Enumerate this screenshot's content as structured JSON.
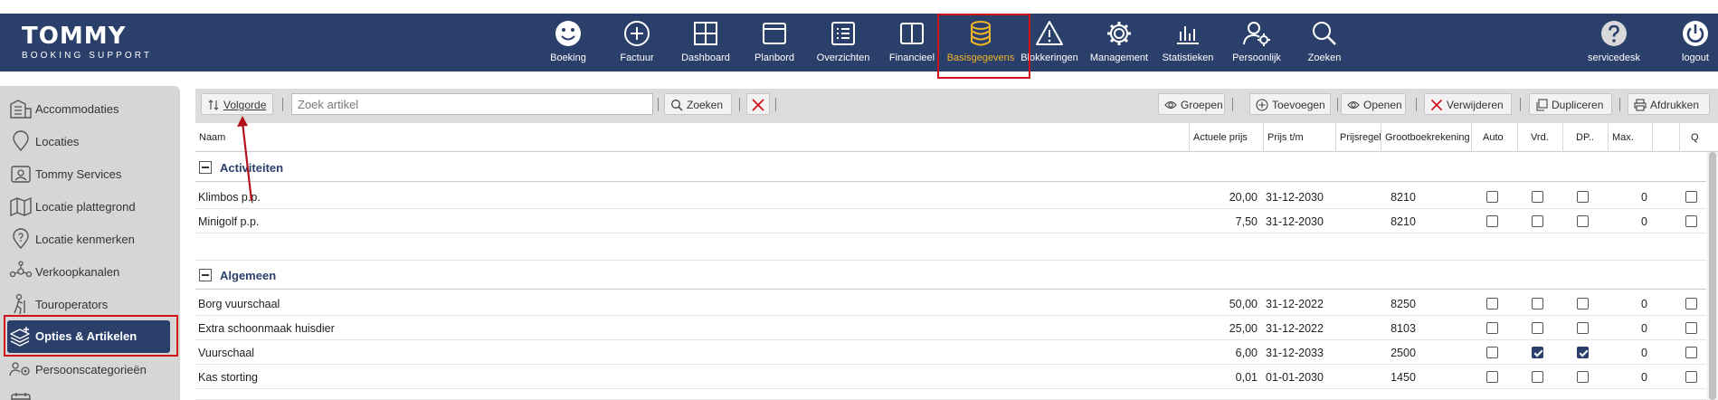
{
  "brand": {
    "name": "TOMMY",
    "tagline": "BOOKING SUPPORT"
  },
  "nav": [
    {
      "label": "Boeking",
      "icon": "smiley-icon"
    },
    {
      "label": "Factuur",
      "icon": "plus-circle-icon"
    },
    {
      "label": "Dashboard",
      "icon": "grid-icon"
    },
    {
      "label": "Planbord",
      "icon": "window-icon"
    },
    {
      "label": "Overzichten",
      "icon": "list-icon"
    },
    {
      "label": "Financieel",
      "icon": "columns-icon"
    },
    {
      "label": "Basisgegevens",
      "icon": "database-icon",
      "active": true
    },
    {
      "label": "Blokkeringen",
      "icon": "warning-icon"
    },
    {
      "label": "Management",
      "icon": "gear-icon"
    },
    {
      "label": "Statistieken",
      "icon": "bar-chart-icon"
    },
    {
      "label": "Persoonlijk",
      "icon": "user-gear-icon"
    },
    {
      "label": "Zoeken",
      "icon": "search-icon"
    }
  ],
  "nav_right": [
    {
      "label": "servicedesk",
      "icon": "help-icon"
    },
    {
      "label": "logout",
      "icon": "power-icon"
    }
  ],
  "sidebar": {
    "items": [
      {
        "label": "Accommodaties"
      },
      {
        "label": "Locaties"
      },
      {
        "label": "Tommy Services"
      },
      {
        "label": "Locatie plattegrond"
      },
      {
        "label": "Locatie kenmerken"
      },
      {
        "label": "Verkoopkanalen"
      },
      {
        "label": "Touroperators"
      },
      {
        "label": "Opties & Artikelen",
        "active": true
      },
      {
        "label": "Persoonscategorieën"
      }
    ]
  },
  "toolbar": {
    "sort_label": "Volgorde",
    "search_placeholder": "Zoek artikel",
    "search_label": "Zoeken",
    "groups_label": "Groepen",
    "add_label": "Toevoegen",
    "open_label": "Openen",
    "delete_label": "Verwijderen",
    "duplicate_label": "Dupliceren",
    "print_label": "Afdrukken"
  },
  "table": {
    "columns": [
      "Naam",
      "Actuele prijs",
      "Prijs t/m",
      "Prijsregel",
      "Grootboekrekening",
      "Auto",
      "Vrd.",
      "DP..",
      "Max.",
      "",
      "Q"
    ],
    "groups": [
      {
        "name": "Activiteiten",
        "rows": [
          {
            "name": "Klimbos p.p.",
            "price": "20,00",
            "until": "31-12-2030",
            "ledger": "8210",
            "auto": false,
            "vrd": false,
            "dp": false,
            "max": "0",
            "q": false
          },
          {
            "name": "Minigolf p.p.",
            "price": "7,50",
            "until": "31-12-2030",
            "ledger": "8210",
            "auto": false,
            "vrd": false,
            "dp": false,
            "max": "0",
            "q": false
          }
        ]
      },
      {
        "name": "Algemeen",
        "rows": [
          {
            "name": "Borg vuurschaal",
            "price": "50,00",
            "until": "31-12-2022",
            "ledger": "8250",
            "auto": false,
            "vrd": false,
            "dp": false,
            "max": "0",
            "q": false
          },
          {
            "name": "Extra schoonmaak huisdier",
            "price": "25,00",
            "until": "31-12-2022",
            "ledger": "8103",
            "auto": false,
            "vrd": false,
            "dp": false,
            "max": "0",
            "q": false
          },
          {
            "name": "Vuurschaal",
            "price": "6,00",
            "until": "31-12-2033",
            "ledger": "2500",
            "auto": false,
            "vrd": true,
            "dp": true,
            "max": "0",
            "q": false
          },
          {
            "name": "Kas storting",
            "price": "0,01",
            "until": "01-01-2030",
            "ledger": "1450",
            "auto": false,
            "vrd": false,
            "dp": false,
            "max": "0",
            "q": false
          }
        ]
      }
    ]
  },
  "colors": {
    "nav_bg": "#2b3f6b",
    "active_nav": "#f0b429",
    "highlight": "#d0121b"
  }
}
